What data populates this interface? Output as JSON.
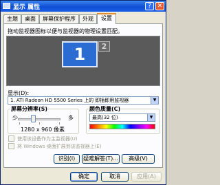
{
  "window": {
    "title": "显示 属性"
  },
  "tabs": [
    {
      "label": "主题"
    },
    {
      "label": "桌面"
    },
    {
      "label": "屏幕保护程序"
    },
    {
      "label": "外观"
    },
    {
      "label": "设置"
    }
  ],
  "instruction": "拖动监视器图标以便与监视器的物理设置匹配。",
  "monitors": [
    {
      "number": "1"
    },
    {
      "number": "2"
    }
  ],
  "display": {
    "label": "显示(D):",
    "value": "1. ATI Radeon HD 5500 Series 上的 即插即用监视器"
  },
  "resolution": {
    "group_label": "屏幕分辨率(S)",
    "less": "少",
    "more": "多",
    "value_text": "1280 x 960 像素",
    "slider_level": 0.35
  },
  "color_quality": {
    "group_label": "颜色质量(C)",
    "value": "最高(32 位)"
  },
  "checkboxes": [
    {
      "label": "使用该设备作为主监视器(U)"
    },
    {
      "label": "将 Windows 桌面扩展到该监视器上(E)"
    }
  ],
  "panel_buttons": {
    "identify": "识别(I)",
    "troubleshoot": "疑难解答(T)...",
    "advanced": "高级(V)"
  },
  "dialog_buttons": {
    "ok": "确定",
    "cancel": "取消",
    "apply": "应用(A)"
  }
}
